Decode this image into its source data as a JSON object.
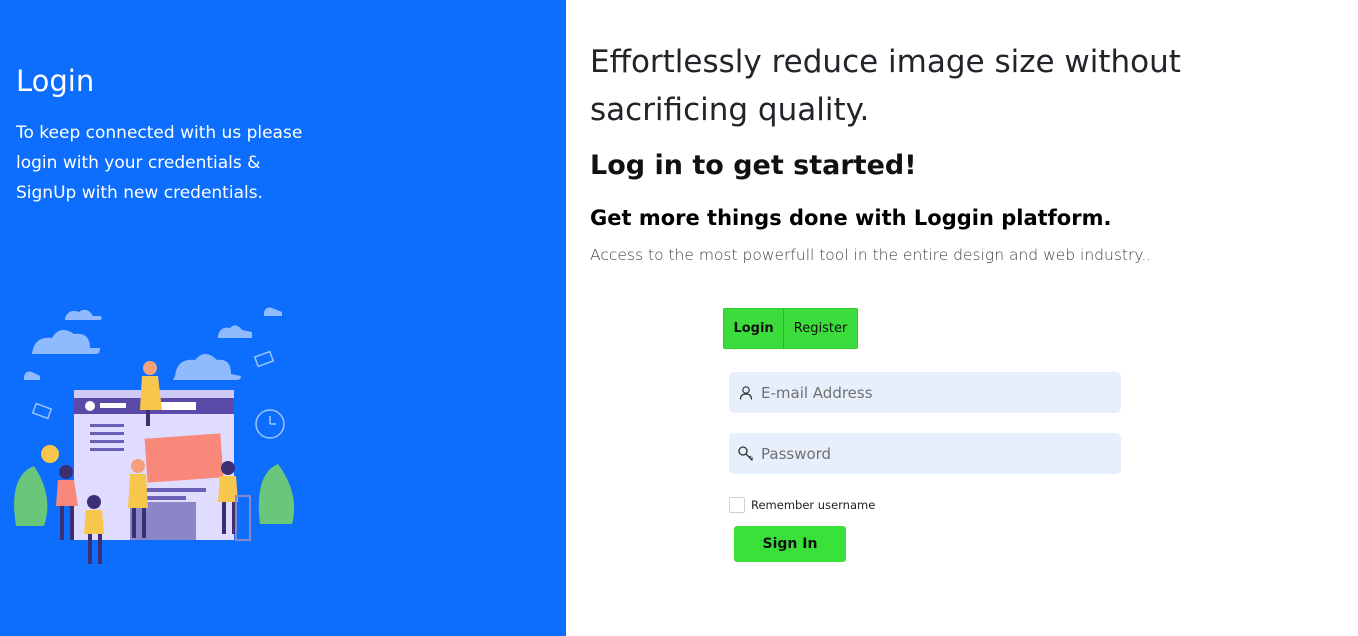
{
  "left": {
    "title": "Login",
    "text": "To keep connected with us please login with your credentials & SignUp with new credentials."
  },
  "right": {
    "headline": "Effortlessly reduce image size without sacrificing quality.",
    "sub1": "Log in to get started!",
    "sub2": "Get more things done with Loggin platform.",
    "description": "Access to the most powerfull tool in the entire design and web industry.."
  },
  "tabs": {
    "login": "Login",
    "register": "Register"
  },
  "form": {
    "email_placeholder": "E-mail Address",
    "password_placeholder": "Password",
    "remember_label": "Remember username",
    "remember_checked": false,
    "signin_label": "Sign In"
  },
  "colors": {
    "left_bg": "#0d6efd",
    "accent_green": "#3bdc3b",
    "field_bg": "#e8effc"
  },
  "icons": [
    "user-icon",
    "key-icon",
    "website-illustration"
  ]
}
